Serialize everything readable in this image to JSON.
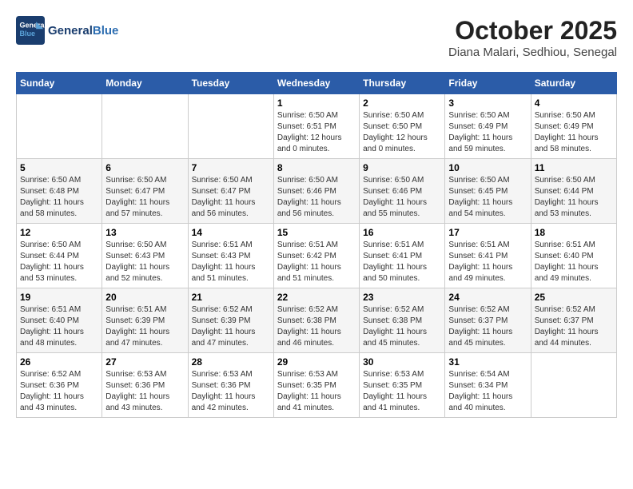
{
  "header": {
    "logo_line1": "General",
    "logo_line2": "Blue",
    "month": "October 2025",
    "location": "Diana Malari, Sedhiou, Senegal"
  },
  "weekdays": [
    "Sunday",
    "Monday",
    "Tuesday",
    "Wednesday",
    "Thursday",
    "Friday",
    "Saturday"
  ],
  "weeks": [
    [
      {
        "day": "",
        "info": ""
      },
      {
        "day": "",
        "info": ""
      },
      {
        "day": "",
        "info": ""
      },
      {
        "day": "1",
        "info": "Sunrise: 6:50 AM\nSunset: 6:51 PM\nDaylight: 12 hours\nand 0 minutes."
      },
      {
        "day": "2",
        "info": "Sunrise: 6:50 AM\nSunset: 6:50 PM\nDaylight: 12 hours\nand 0 minutes."
      },
      {
        "day": "3",
        "info": "Sunrise: 6:50 AM\nSunset: 6:49 PM\nDaylight: 11 hours\nand 59 minutes."
      },
      {
        "day": "4",
        "info": "Sunrise: 6:50 AM\nSunset: 6:49 PM\nDaylight: 11 hours\nand 58 minutes."
      }
    ],
    [
      {
        "day": "5",
        "info": "Sunrise: 6:50 AM\nSunset: 6:48 PM\nDaylight: 11 hours\nand 58 minutes."
      },
      {
        "day": "6",
        "info": "Sunrise: 6:50 AM\nSunset: 6:47 PM\nDaylight: 11 hours\nand 57 minutes."
      },
      {
        "day": "7",
        "info": "Sunrise: 6:50 AM\nSunset: 6:47 PM\nDaylight: 11 hours\nand 56 minutes."
      },
      {
        "day": "8",
        "info": "Sunrise: 6:50 AM\nSunset: 6:46 PM\nDaylight: 11 hours\nand 56 minutes."
      },
      {
        "day": "9",
        "info": "Sunrise: 6:50 AM\nSunset: 6:46 PM\nDaylight: 11 hours\nand 55 minutes."
      },
      {
        "day": "10",
        "info": "Sunrise: 6:50 AM\nSunset: 6:45 PM\nDaylight: 11 hours\nand 54 minutes."
      },
      {
        "day": "11",
        "info": "Sunrise: 6:50 AM\nSunset: 6:44 PM\nDaylight: 11 hours\nand 53 minutes."
      }
    ],
    [
      {
        "day": "12",
        "info": "Sunrise: 6:50 AM\nSunset: 6:44 PM\nDaylight: 11 hours\nand 53 minutes."
      },
      {
        "day": "13",
        "info": "Sunrise: 6:50 AM\nSunset: 6:43 PM\nDaylight: 11 hours\nand 52 minutes."
      },
      {
        "day": "14",
        "info": "Sunrise: 6:51 AM\nSunset: 6:43 PM\nDaylight: 11 hours\nand 51 minutes."
      },
      {
        "day": "15",
        "info": "Sunrise: 6:51 AM\nSunset: 6:42 PM\nDaylight: 11 hours\nand 51 minutes."
      },
      {
        "day": "16",
        "info": "Sunrise: 6:51 AM\nSunset: 6:41 PM\nDaylight: 11 hours\nand 50 minutes."
      },
      {
        "day": "17",
        "info": "Sunrise: 6:51 AM\nSunset: 6:41 PM\nDaylight: 11 hours\nand 49 minutes."
      },
      {
        "day": "18",
        "info": "Sunrise: 6:51 AM\nSunset: 6:40 PM\nDaylight: 11 hours\nand 49 minutes."
      }
    ],
    [
      {
        "day": "19",
        "info": "Sunrise: 6:51 AM\nSunset: 6:40 PM\nDaylight: 11 hours\nand 48 minutes."
      },
      {
        "day": "20",
        "info": "Sunrise: 6:51 AM\nSunset: 6:39 PM\nDaylight: 11 hours\nand 47 minutes."
      },
      {
        "day": "21",
        "info": "Sunrise: 6:52 AM\nSunset: 6:39 PM\nDaylight: 11 hours\nand 47 minutes."
      },
      {
        "day": "22",
        "info": "Sunrise: 6:52 AM\nSunset: 6:38 PM\nDaylight: 11 hours\nand 46 minutes."
      },
      {
        "day": "23",
        "info": "Sunrise: 6:52 AM\nSunset: 6:38 PM\nDaylight: 11 hours\nand 45 minutes."
      },
      {
        "day": "24",
        "info": "Sunrise: 6:52 AM\nSunset: 6:37 PM\nDaylight: 11 hours\nand 45 minutes."
      },
      {
        "day": "25",
        "info": "Sunrise: 6:52 AM\nSunset: 6:37 PM\nDaylight: 11 hours\nand 44 minutes."
      }
    ],
    [
      {
        "day": "26",
        "info": "Sunrise: 6:52 AM\nSunset: 6:36 PM\nDaylight: 11 hours\nand 43 minutes."
      },
      {
        "day": "27",
        "info": "Sunrise: 6:53 AM\nSunset: 6:36 PM\nDaylight: 11 hours\nand 43 minutes."
      },
      {
        "day": "28",
        "info": "Sunrise: 6:53 AM\nSunset: 6:36 PM\nDaylight: 11 hours\nand 42 minutes."
      },
      {
        "day": "29",
        "info": "Sunrise: 6:53 AM\nSunset: 6:35 PM\nDaylight: 11 hours\nand 41 minutes."
      },
      {
        "day": "30",
        "info": "Sunrise: 6:53 AM\nSunset: 6:35 PM\nDaylight: 11 hours\nand 41 minutes."
      },
      {
        "day": "31",
        "info": "Sunrise: 6:54 AM\nSunset: 6:34 PM\nDaylight: 11 hours\nand 40 minutes."
      },
      {
        "day": "",
        "info": ""
      }
    ]
  ]
}
